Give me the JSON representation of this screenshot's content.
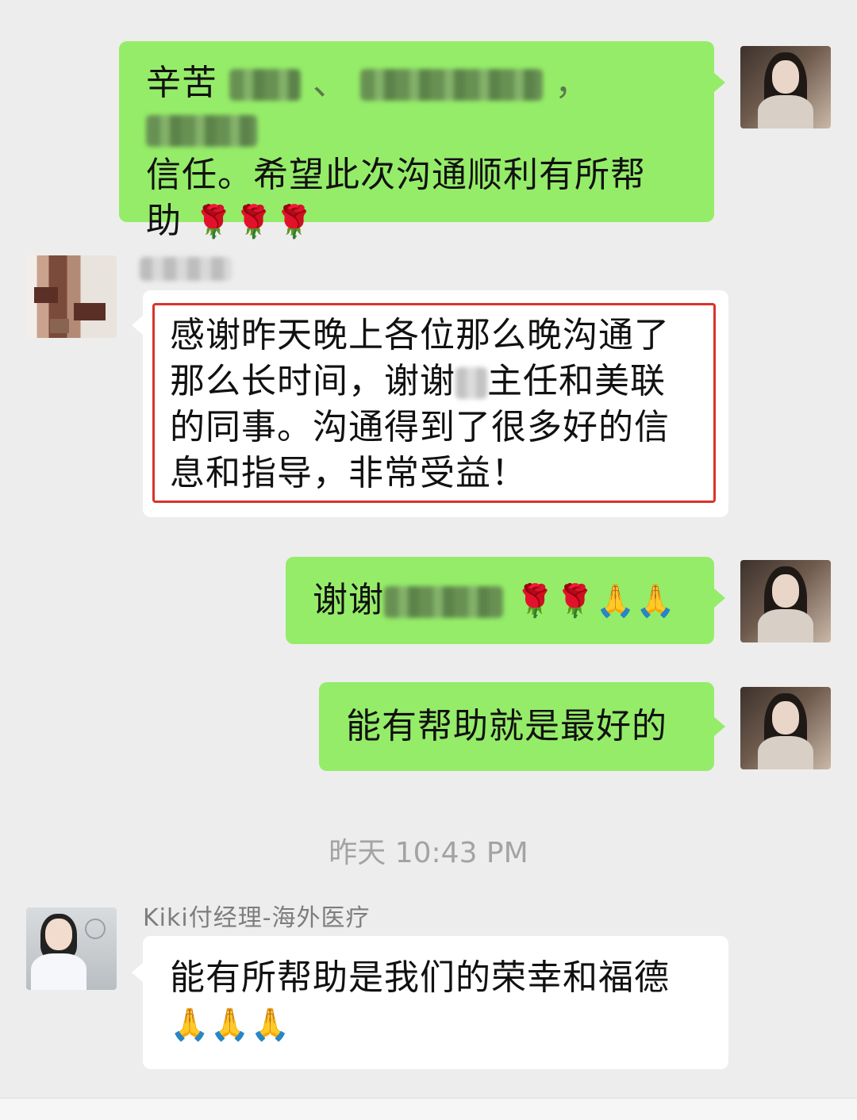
{
  "chat": {
    "messages": [
      {
        "side": "right",
        "text_start": "辛苦",
        "text_line2": "信任。希望此次沟通顺利有所帮",
        "text_line3": "助",
        "emojis": "🌹🌹🌹"
      },
      {
        "side": "left",
        "line1": "感谢昨天晚上各位那么晚沟通了",
        "line2a": "那么长时间，谢谢",
        "line2b": "主任和美联",
        "line3": "的同事。沟通得到了很多好的信",
        "line4": "息和指导，非常受益！"
      },
      {
        "side": "right",
        "text_start": "谢谢",
        "emojis": "🌹🌹🙏🙏"
      },
      {
        "side": "right",
        "text": "能有帮助就是最好的"
      }
    ],
    "timestamp": "昨天 10:43 PM",
    "last_message": {
      "sender": "Kiki付经理-海外医疗",
      "line1": "能有所帮助是我们的荣幸和福德",
      "emojis": "🙏🙏🙏"
    }
  },
  "colors": {
    "background": "#ededed",
    "self_bubble": "#95ec69",
    "other_bubble": "#ffffff",
    "highlight_border": "#d9342b"
  }
}
